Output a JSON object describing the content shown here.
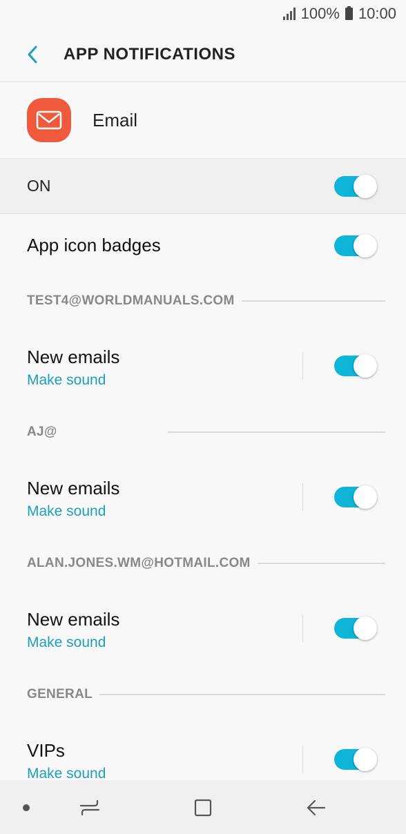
{
  "status": {
    "battery": "100%",
    "time": "10:00"
  },
  "appbar": {
    "title": "APP NOTIFICATIONS"
  },
  "app": {
    "name": "Email"
  },
  "master": {
    "label": "ON",
    "enabled": true
  },
  "badges": {
    "label": "App icon badges",
    "enabled": true
  },
  "accounts": [
    {
      "header": "TEST4@WORLDMANUALS.COM",
      "item": "New emails",
      "sub": "Make sound",
      "enabled": true
    },
    {
      "header": "AJ@",
      "item": "New emails",
      "sub": "Make sound",
      "enabled": true
    },
    {
      "header": "ALAN.JONES.WM@HOTMAIL.COM",
      "item": "New emails",
      "sub": "Make sound",
      "enabled": true
    }
  ],
  "general": {
    "header": "GENERAL",
    "item": "VIPs",
    "sub": "Make sound",
    "enabled": true
  },
  "colors": {
    "accent": "#0fb4d9",
    "link": "#1c9fbd",
    "app_icon": "#f05a3c"
  },
  "icons": {
    "signal": "signal-icon",
    "battery": "battery-icon",
    "back": "back-chevron-icon",
    "app": "envelope-icon",
    "nav_dot": "dot-icon",
    "nav_recents": "recents-icon",
    "nav_home": "home-square-icon",
    "nav_back": "back-arrow-icon"
  }
}
